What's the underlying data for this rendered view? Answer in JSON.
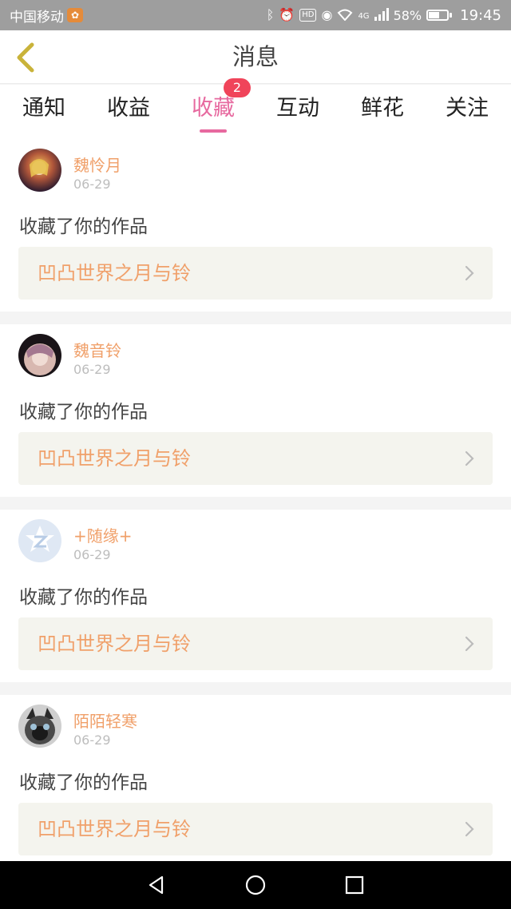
{
  "status_bar": {
    "carrier": "中国移动",
    "network": "4G",
    "battery": "58%",
    "battery_level": 0.58,
    "time": "19:45"
  },
  "header": {
    "title": "消息"
  },
  "tabs": [
    {
      "label": "通知",
      "active": false
    },
    {
      "label": "收益",
      "active": false
    },
    {
      "label": "收藏",
      "active": true,
      "badge": "2"
    },
    {
      "label": "互动",
      "active": false
    },
    {
      "label": "鲜花",
      "active": false
    },
    {
      "label": "关注",
      "active": false
    }
  ],
  "messages": [
    {
      "user": "魏怜月",
      "date": "06-29",
      "action": "收藏了你的作品",
      "work": "凹凸世界之月与铃",
      "avatar": "anime-avatar"
    },
    {
      "user": "魏音铃",
      "date": "06-29",
      "action": "收藏了你的作品",
      "work": "凹凸世界之月与铃",
      "avatar": "anime-avatar"
    },
    {
      "user": "+随缘+",
      "date": "06-29",
      "action": "收藏了你的作品",
      "work": "凹凸世界之月与铃",
      "avatar": "default-avatar"
    },
    {
      "user": "陌陌轻寒",
      "date": "06-29",
      "action": "收藏了你的作品",
      "work": "凹凸世界之月与铃",
      "avatar": "cat-avatar"
    }
  ],
  "colors": {
    "accent_pink": "#e7699f",
    "badge_red": "#f0445a",
    "name_orange": "#f0a06a",
    "back_arrow": "#c9b33a"
  },
  "nav": {
    "back": "back-triangle-icon",
    "home": "home-circle-icon",
    "recents": "recents-square-icon"
  }
}
